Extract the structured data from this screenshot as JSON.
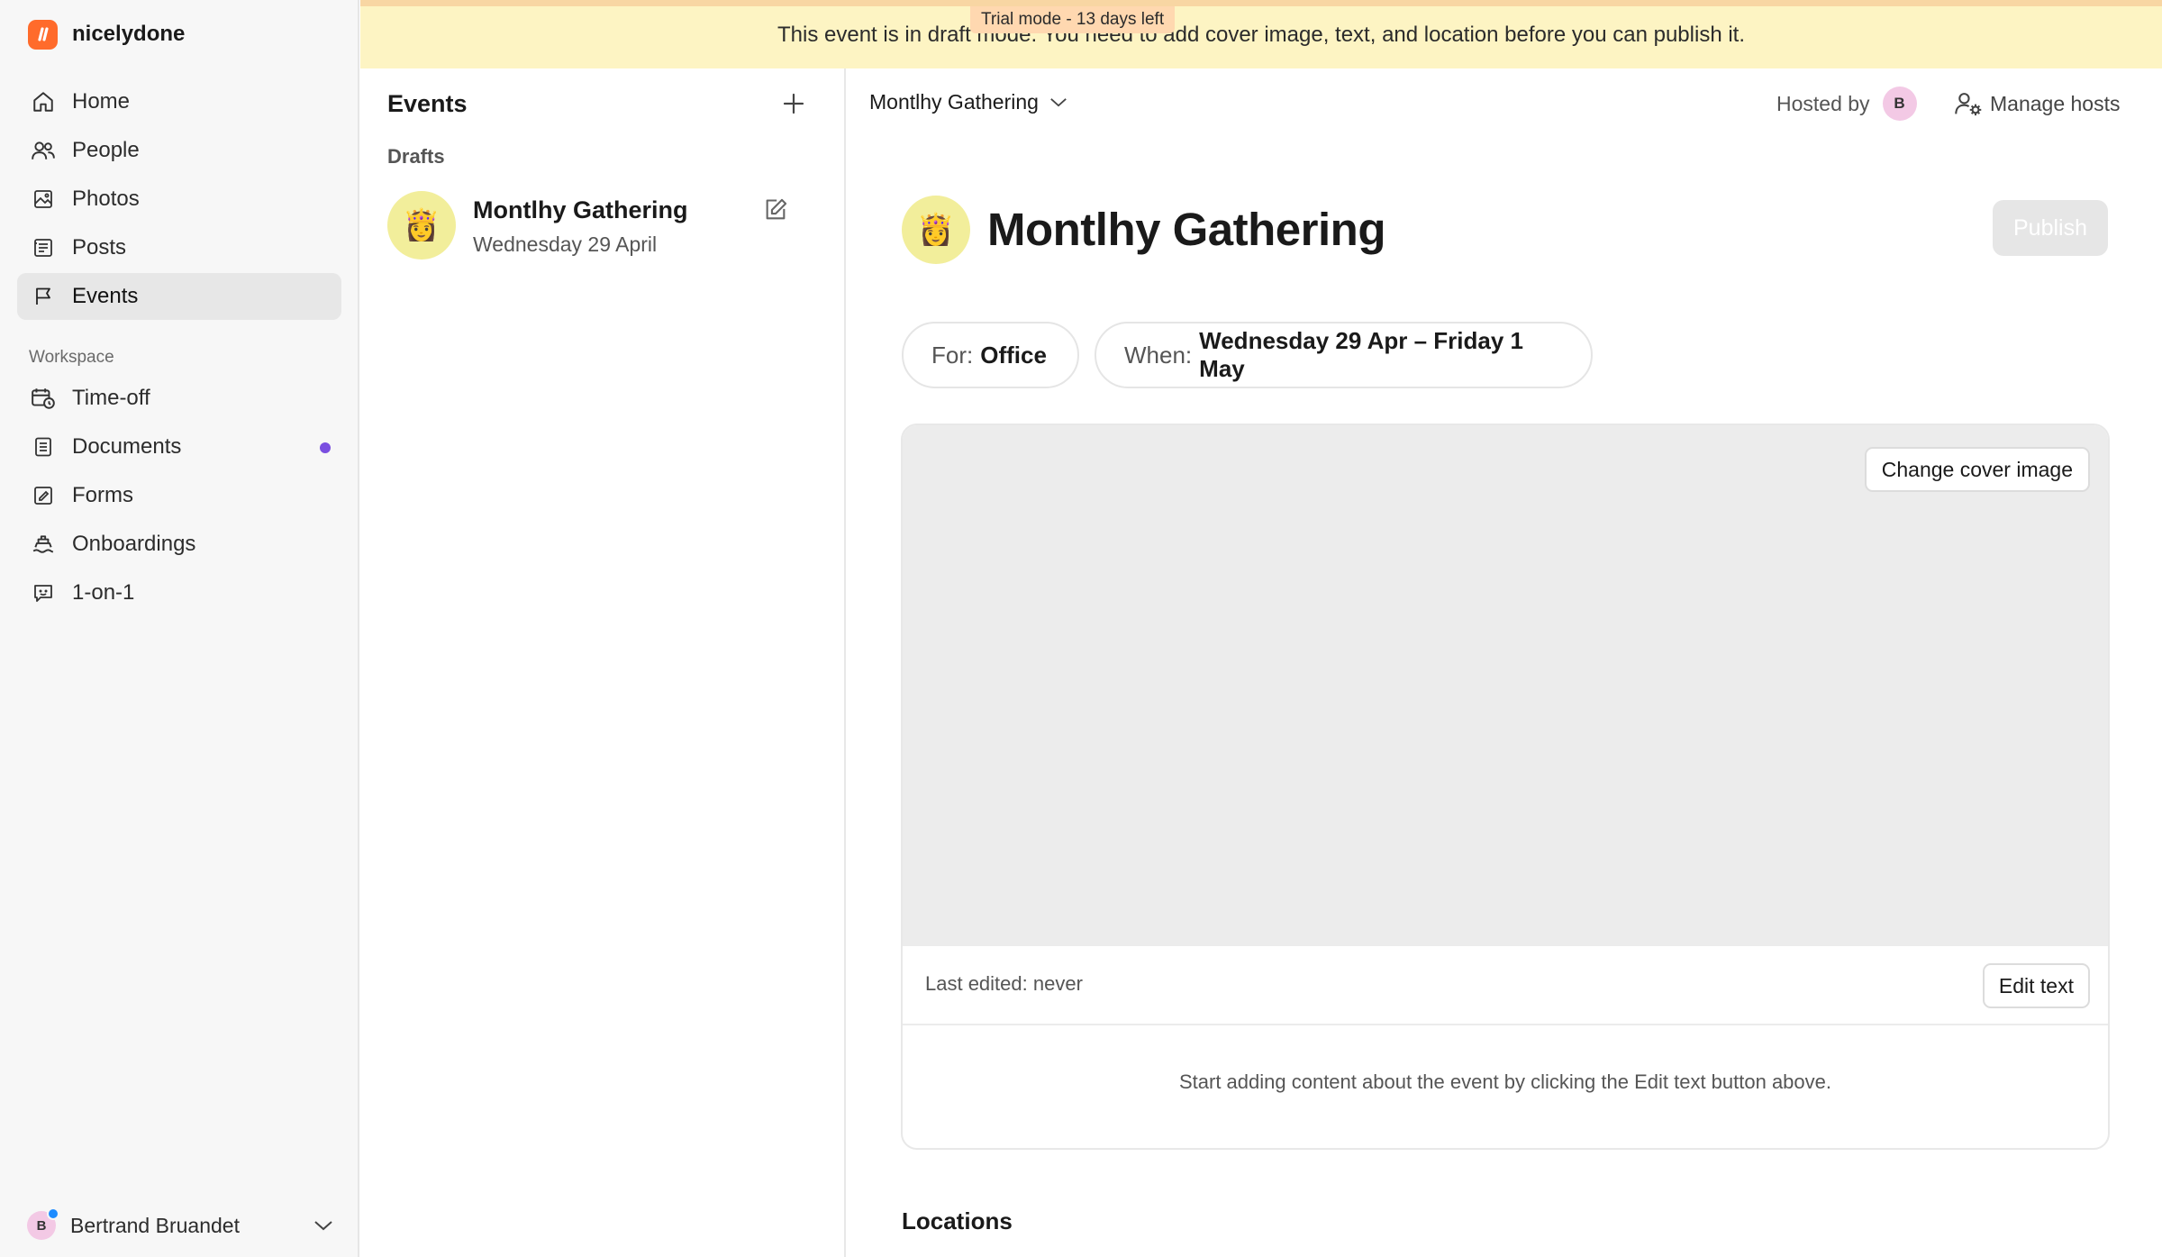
{
  "brand": {
    "name": "nicelydone",
    "color": "#ff6b2b"
  },
  "sidebar": {
    "main_items": [
      {
        "label": "Home",
        "icon": "home-icon"
      },
      {
        "label": "People",
        "icon": "people-icon"
      },
      {
        "label": "Photos",
        "icon": "photos-icon"
      },
      {
        "label": "Posts",
        "icon": "posts-icon"
      },
      {
        "label": "Events",
        "icon": "flag-icon",
        "active": true
      }
    ],
    "workspace_label": "Workspace",
    "workspace_items": [
      {
        "label": "Time-off",
        "icon": "calendar-clock-icon"
      },
      {
        "label": "Documents",
        "icon": "document-icon",
        "has_dot": true
      },
      {
        "label": "Forms",
        "icon": "form-icon"
      },
      {
        "label": "Onboardings",
        "icon": "ship-icon"
      },
      {
        "label": "1-on-1",
        "icon": "chat-icon"
      }
    ],
    "user": {
      "initial": "B",
      "name": "Bertrand Bruandet"
    }
  },
  "banner": {
    "message": "This event is in draft mode. You need to add cover image, text, and location before you can publish it.",
    "trial": "Trial mode - 13 days left"
  },
  "events_panel": {
    "title": "Events",
    "section": "Drafts",
    "items": [
      {
        "emoji": "👸",
        "name": "Montlhy Gathering",
        "date": "Wednesday 29 April"
      }
    ]
  },
  "main": {
    "selector_label": "Montlhy Gathering",
    "hosted_by_label": "Hosted by",
    "host_initial": "B",
    "manage_hosts_label": "Manage hosts",
    "event_emoji": "👸",
    "title": "Montlhy Gathering",
    "publish_label": "Publish",
    "for_label": "For:",
    "for_value": "Office",
    "when_label": "When:",
    "when_value": "Wednesday 29 Apr – Friday 1 May",
    "change_cover_label": "Change cover image",
    "last_edited": "Last edited: never",
    "edit_text_label": "Edit text",
    "empty_hint": "Start adding content about the event by clicking the Edit text button above.",
    "locations_title": "Locations"
  }
}
